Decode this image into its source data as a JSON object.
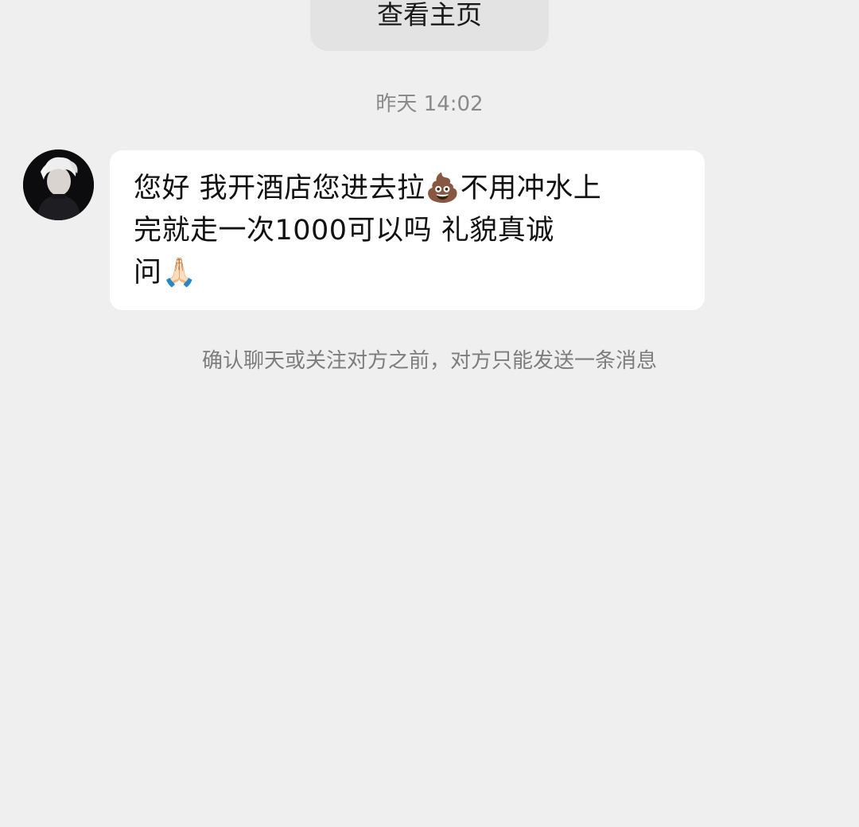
{
  "header": {
    "view_profile_label": "查看主页"
  },
  "chat": {
    "timestamp": "昨天 14:02",
    "messages": [
      {
        "sender_avatar_icon": "user-avatar",
        "text": "您好 我开酒店您进去拉💩不用冲水上\n完就走一次1000可以吗 礼貌真诚\n问🙏🏻"
      }
    ],
    "notice": "确认聊天或关注对方之前，对方只能发送一条消息"
  },
  "colors": {
    "background": "#efefef",
    "bubble": "#ffffff",
    "button": "#e3e3e3",
    "muted_text": "#8a8a8a"
  }
}
